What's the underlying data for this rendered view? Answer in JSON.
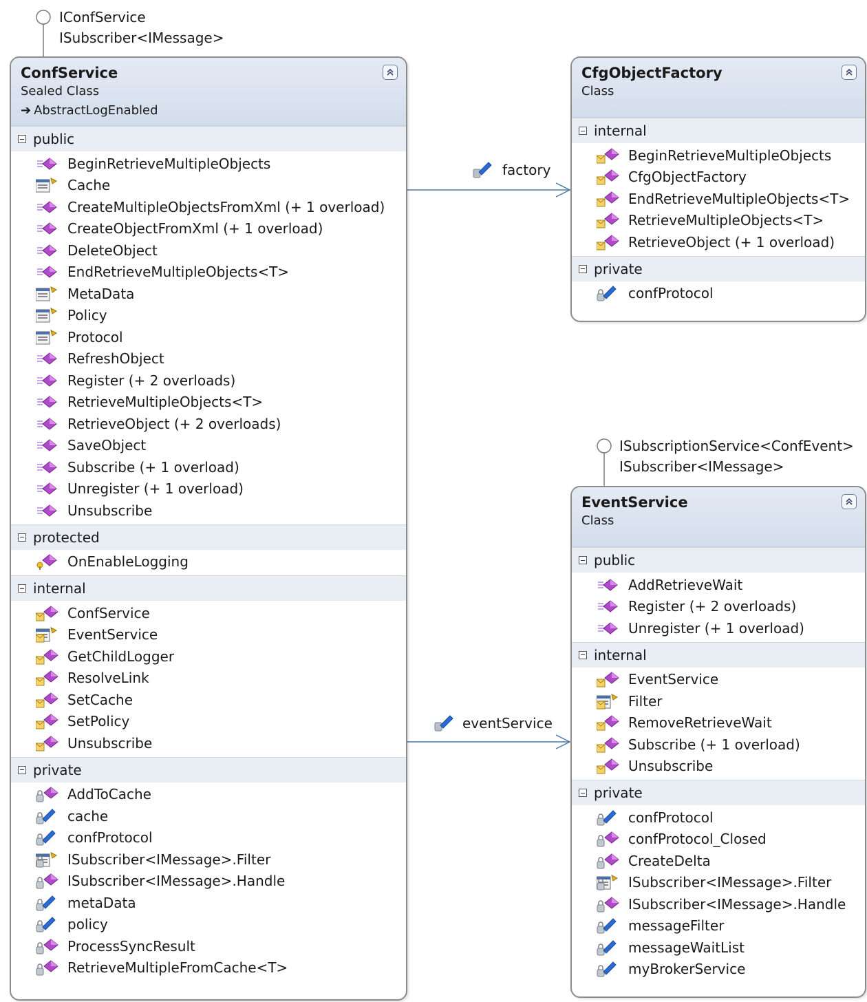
{
  "interfaces": {
    "confservice": [
      "IConfService",
      "ISubscriber<IMessage>"
    ],
    "eventservice": [
      "ISubscriptionService<ConfEvent>",
      "ISubscriber<IMessage>"
    ]
  },
  "associations": {
    "factory": "factory",
    "eventService": "eventService"
  },
  "confService": {
    "name": "ConfService",
    "kind": "Sealed Class",
    "base": "AbstractLogEnabled",
    "sections": [
      {
        "label": "public",
        "members": [
          {
            "name": "BeginRetrieveMultipleObjects",
            "icon": "method-icon"
          },
          {
            "name": "Cache",
            "icon": "property-icon"
          },
          {
            "name": "CreateMultipleObjectsFromXml (+ 1 overload)",
            "icon": "method-icon"
          },
          {
            "name": "CreateObjectFromXml (+ 1 overload)",
            "icon": "method-icon"
          },
          {
            "name": "DeleteObject",
            "icon": "method-icon"
          },
          {
            "name": "EndRetrieveMultipleObjects<T>",
            "icon": "method-icon"
          },
          {
            "name": "MetaData",
            "icon": "property-icon"
          },
          {
            "name": "Policy",
            "icon": "property-icon"
          },
          {
            "name": "Protocol",
            "icon": "property-icon"
          },
          {
            "name": "RefreshObject",
            "icon": "method-icon"
          },
          {
            "name": "Register (+ 2 overloads)",
            "icon": "method-icon"
          },
          {
            "name": "RetrieveMultipleObjects<T>",
            "icon": "method-icon"
          },
          {
            "name": "RetrieveObject (+ 2 overloads)",
            "icon": "method-icon"
          },
          {
            "name": "SaveObject",
            "icon": "method-icon"
          },
          {
            "name": "Subscribe (+ 1 overload)",
            "icon": "method-icon"
          },
          {
            "name": "Unregister (+ 1 overload)",
            "icon": "method-icon"
          },
          {
            "name": "Unsubscribe",
            "icon": "method-icon"
          }
        ]
      },
      {
        "label": "protected",
        "members": [
          {
            "name": "OnEnableLogging",
            "icon": "protected-method-icon"
          }
        ]
      },
      {
        "label": "internal",
        "members": [
          {
            "name": "ConfService",
            "icon": "internal-method-icon"
          },
          {
            "name": "EventService",
            "icon": "internal-property-icon"
          },
          {
            "name": "GetChildLogger",
            "icon": "internal-method-icon"
          },
          {
            "name": "ResolveLink",
            "icon": "internal-method-icon"
          },
          {
            "name": "SetCache",
            "icon": "internal-method-icon"
          },
          {
            "name": "SetPolicy",
            "icon": "internal-method-icon"
          },
          {
            "name": "Unsubscribe",
            "icon": "internal-method-icon"
          }
        ]
      },
      {
        "label": "private",
        "members": [
          {
            "name": "AddToCache",
            "icon": "private-method-icon"
          },
          {
            "name": "cache",
            "icon": "private-field-icon"
          },
          {
            "name": "confProtocol",
            "icon": "private-field-icon"
          },
          {
            "name": "ISubscriber<IMessage>.Filter",
            "icon": "private-property-icon"
          },
          {
            "name": "ISubscriber<IMessage>.Handle",
            "icon": "private-method-icon"
          },
          {
            "name": "metaData",
            "icon": "private-field-icon"
          },
          {
            "name": "policy",
            "icon": "private-field-icon"
          },
          {
            "name": "ProcessSyncResult",
            "icon": "private-method-icon"
          },
          {
            "name": "RetrieveMultipleFromCache<T>",
            "icon": "private-method-icon"
          }
        ]
      }
    ]
  },
  "cfgObjectFactory": {
    "name": "CfgObjectFactory",
    "kind": "Class",
    "sections": [
      {
        "label": "internal",
        "members": [
          {
            "name": "BeginRetrieveMultipleObjects",
            "icon": "internal-method-icon"
          },
          {
            "name": "CfgObjectFactory",
            "icon": "internal-method-icon"
          },
          {
            "name": "EndRetrieveMultipleObjects<T>",
            "icon": "internal-method-icon"
          },
          {
            "name": "RetrieveMultipleObjects<T>",
            "icon": "internal-method-icon"
          },
          {
            "name": "RetrieveObject (+ 1 overload)",
            "icon": "internal-method-icon"
          }
        ]
      },
      {
        "label": "private",
        "members": [
          {
            "name": "confProtocol",
            "icon": "private-field-icon"
          }
        ]
      }
    ]
  },
  "eventServiceClass": {
    "name": "EventService",
    "kind": "Class",
    "sections": [
      {
        "label": "public",
        "members": [
          {
            "name": "AddRetrieveWait",
            "icon": "method-icon"
          },
          {
            "name": "Register (+ 2 overloads)",
            "icon": "method-icon"
          },
          {
            "name": "Unregister (+ 1 overload)",
            "icon": "method-icon"
          }
        ]
      },
      {
        "label": "internal",
        "members": [
          {
            "name": "EventService",
            "icon": "internal-method-icon"
          },
          {
            "name": "Filter",
            "icon": "internal-property-icon"
          },
          {
            "name": "RemoveRetrieveWait",
            "icon": "internal-method-icon"
          },
          {
            "name": "Subscribe (+ 1 overload)",
            "icon": "internal-method-icon"
          },
          {
            "name": "Unsubscribe",
            "icon": "internal-method-icon"
          }
        ]
      },
      {
        "label": "private",
        "members": [
          {
            "name": "confProtocol",
            "icon": "private-field-icon"
          },
          {
            "name": "confProtocol_Closed",
            "icon": "private-method-icon"
          },
          {
            "name": "CreateDelta",
            "icon": "private-method-icon"
          },
          {
            "name": "ISubscriber<IMessage>.Filter",
            "icon": "private-property-icon"
          },
          {
            "name": "ISubscriber<IMessage>.Handle",
            "icon": "private-method-icon"
          },
          {
            "name": "messageFilter",
            "icon": "private-field-icon"
          },
          {
            "name": "messageWaitList",
            "icon": "private-field-icon"
          },
          {
            "name": "myBrokerService",
            "icon": "private-field-icon"
          }
        ]
      }
    ]
  }
}
